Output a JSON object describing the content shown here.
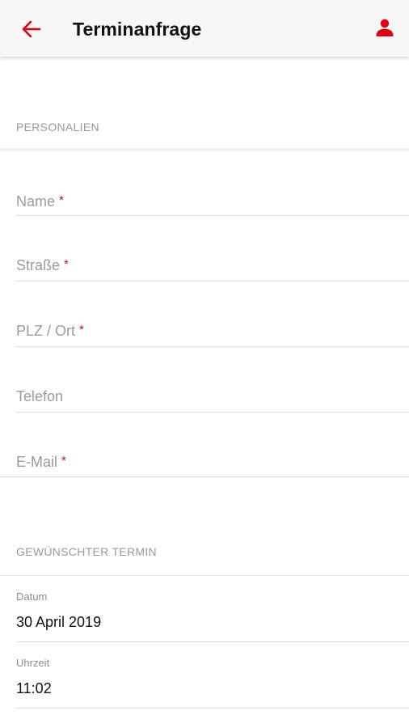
{
  "appbar": {
    "title": "Terminanfrage",
    "accent_color": "#e3000f",
    "back_icon": "arrow-left-icon",
    "user_icon": "person-icon"
  },
  "personalien": {
    "header": "PERSONALIEN",
    "required_marker": "*",
    "fields": [
      {
        "placeholder": "Name",
        "required": true
      },
      {
        "placeholder": "Straße",
        "required": true
      },
      {
        "placeholder": "PLZ / Ort",
        "required": true
      },
      {
        "placeholder": "Telefon",
        "required": false
      },
      {
        "placeholder": "E-Mail",
        "required": true
      }
    ]
  },
  "termin": {
    "header": "GEWÜNSCHTER TERMIN",
    "date_label": "Datum",
    "date_value": "30 April 2019",
    "time_label": "Uhrzeit",
    "time_value": "11:02"
  }
}
